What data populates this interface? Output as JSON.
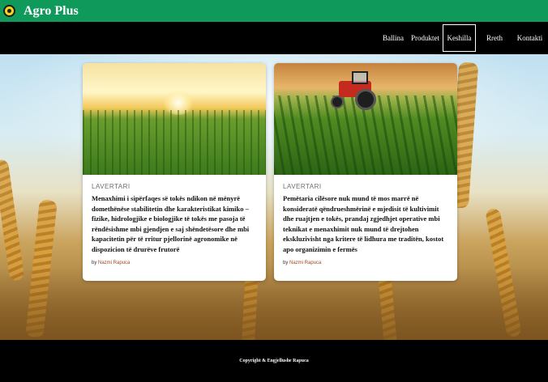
{
  "header": {
    "brand": "Agro Plus",
    "logo_icon": "leaf-logo-icon"
  },
  "nav": {
    "items": [
      {
        "label": "Ballina",
        "active": false
      },
      {
        "label": "Produktet",
        "active": false
      },
      {
        "label": "Keshilla",
        "active": true
      },
      {
        "label": "Rreth nesh",
        "active": false
      },
      {
        "label": "Kontakti",
        "active": false
      }
    ]
  },
  "cards": [
    {
      "category": "LAVERTARI",
      "excerpt": "Menaxhimi i sipërfaqes së tokës ndikon në mënyrë domethënëse stabilitetin dhe karakteristikat kimiko – fizike, hidrologjike e biologjike të tokës me pasoja të rëndësishme mbi gjendjen e saj shëndetësore dhe mbi kapacitetin për të rritur pjellorinë agronomike në dispozicion të drurëve frutorë",
      "by": "by",
      "author": "Nazmi Rapuca"
    },
    {
      "category": "LAVERTARI",
      "excerpt": "Pemëtaria cilësore nuk mund të mos marrë në konsideratë qëndrueshmërinë e mjedisit të kultivimit dhe ruajtjen e tokës, prandaj zgjedhjet operative mbi teknikat e menaxhimit nuk mund të drejtohen ekskluzivisht nga kritere të lidhura me traditën, kostot apo organizimin e fermës",
      "by": "by",
      "author": "Nazmi Rapuca"
    }
  ],
  "footer": {
    "copyright": "Copyright & Engjellushe Rapuca"
  },
  "colors": {
    "topbar": "#0f9a5c",
    "navbar": "#000000",
    "footer": "#000000",
    "author_link": "#9a4a21"
  }
}
